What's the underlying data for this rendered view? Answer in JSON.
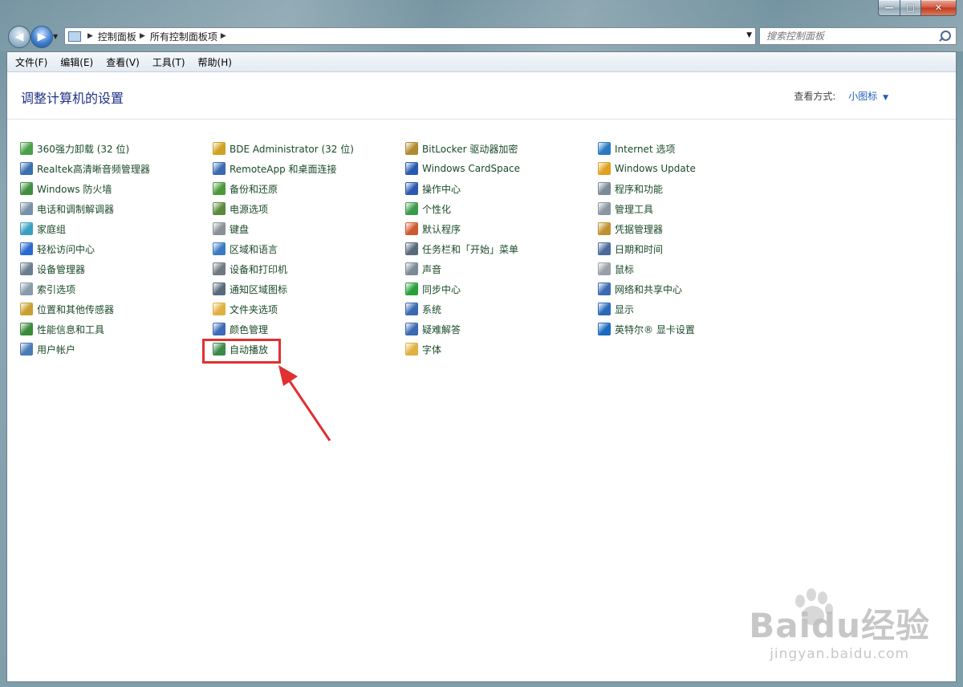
{
  "window": {
    "caption_buttons": {
      "minimize": "—",
      "maximize": "□",
      "close": "✕"
    }
  },
  "nav": {
    "back_icon": "back-arrow-icon",
    "forward_icon": "forward-arrow-icon",
    "address_crumbs": [
      "控制面板",
      "所有控制面板项"
    ],
    "search_placeholder": "搜索控制面板"
  },
  "menubar": {
    "items": [
      "文件(F)",
      "编辑(E)",
      "查看(V)",
      "工具(T)",
      "帮助(H)"
    ]
  },
  "header": {
    "title": "调整计算机的设置",
    "view_by_label": "查看方式:",
    "view_by_value": "小图标"
  },
  "columns": [
    {
      "items": [
        {
          "label": "360强力卸载 (32 位)",
          "icon": "uninstall-icon",
          "color": "#4aa04a"
        },
        {
          "label": "Realtek高清晰音频管理器",
          "icon": "audio-manager-icon",
          "color": "#3a6fb0"
        },
        {
          "label": "Windows 防火墙",
          "icon": "firewall-icon",
          "color": "#3f8f3f"
        },
        {
          "label": "电话和调制解调器",
          "icon": "phone-modem-icon",
          "color": "#7890a8"
        },
        {
          "label": "家庭组",
          "icon": "homegroup-icon",
          "color": "#3aa0c0"
        },
        {
          "label": "轻松访问中心",
          "icon": "ease-access-icon",
          "color": "#2a6ad0"
        },
        {
          "label": "设备管理器",
          "icon": "device-manager-icon",
          "color": "#6a7e90"
        },
        {
          "label": "索引选项",
          "icon": "indexing-icon",
          "color": "#8a9aaa"
        },
        {
          "label": "位置和其他传感器",
          "icon": "sensor-icon",
          "color": "#c8a030"
        },
        {
          "label": "性能信息和工具",
          "icon": "performance-icon",
          "color": "#3a8a3a"
        },
        {
          "label": "用户帐户",
          "icon": "user-accounts-icon",
          "color": "#4a7ab8"
        }
      ]
    },
    {
      "items": [
        {
          "label": "BDE Administrator (32 位)",
          "icon": "bde-icon",
          "color": "#d0a020"
        },
        {
          "label": "RemoteApp 和桌面连接",
          "icon": "remoteapp-icon",
          "color": "#3a6ab0"
        },
        {
          "label": "备份和还原",
          "icon": "backup-icon",
          "color": "#4a9a3a"
        },
        {
          "label": "电源选项",
          "icon": "power-icon",
          "color": "#5a8a3a"
        },
        {
          "label": "键盘",
          "icon": "keyboard-icon",
          "color": "#8a9096"
        },
        {
          "label": "区域和语言",
          "icon": "region-icon",
          "color": "#3a7ac0"
        },
        {
          "label": "设备和打印机",
          "icon": "printer-icon",
          "color": "#707880"
        },
        {
          "label": "通知区域图标",
          "icon": "notification-icon",
          "color": "#5a6a7a"
        },
        {
          "label": "文件夹选项",
          "icon": "folder-options-icon",
          "color": "#e0b040"
        },
        {
          "label": "颜色管理",
          "icon": "color-management-icon",
          "color": "#3a6ab8"
        },
        {
          "label": "自动播放",
          "icon": "autoplay-icon",
          "color": "#3a8a4a"
        }
      ]
    },
    {
      "items": [
        {
          "label": "BitLocker 驱动器加密",
          "icon": "bitlocker-icon",
          "color": "#b08a30"
        },
        {
          "label": "Windows CardSpace",
          "icon": "cardspace-icon",
          "color": "#2a5ab0"
        },
        {
          "label": "操作中心",
          "icon": "action-center-flag-icon",
          "color": "#2a5ab0"
        },
        {
          "label": "个性化",
          "icon": "personalize-icon",
          "color": "#3a9a4a"
        },
        {
          "label": "默认程序",
          "icon": "default-programs-icon",
          "color": "#d05a30"
        },
        {
          "label": "任务栏和「开始」菜单",
          "icon": "taskbar-icon",
          "color": "#5a6a7a"
        },
        {
          "label": "声音",
          "icon": "speaker-icon",
          "color": "#7a8a96"
        },
        {
          "label": "同步中心",
          "icon": "sync-icon",
          "color": "#2aa03a"
        },
        {
          "label": "系统",
          "icon": "system-icon",
          "color": "#3a6ab0"
        },
        {
          "label": "疑难解答",
          "icon": "troubleshoot-icon",
          "color": "#3a6ab0"
        },
        {
          "label": "字体",
          "icon": "fonts-icon",
          "color": "#e0b040"
        }
      ]
    },
    {
      "items": [
        {
          "label": "Internet 选项",
          "icon": "internet-options-icon",
          "color": "#2a7ac0"
        },
        {
          "label": "Windows Update",
          "icon": "windows-update-icon",
          "color": "#e0a020"
        },
        {
          "label": "程序和功能",
          "icon": "programs-features-icon",
          "color": "#7a8a96"
        },
        {
          "label": "管理工具",
          "icon": "admin-tools-icon",
          "color": "#8a96a0"
        },
        {
          "label": "凭据管理器",
          "icon": "credential-icon",
          "color": "#c09030"
        },
        {
          "label": "日期和时间",
          "icon": "clock-icon",
          "color": "#4a6a9a"
        },
        {
          "label": "鼠标",
          "icon": "mouse-icon",
          "color": "#9aa0a6"
        },
        {
          "label": "网络和共享中心",
          "icon": "network-icon",
          "color": "#3a6ab0"
        },
        {
          "label": "显示",
          "icon": "display-icon",
          "color": "#2a6ab8"
        },
        {
          "label": "英特尔® 显卡设置",
          "icon": "intel-graphics-icon",
          "color": "#1a6ac0"
        }
      ]
    }
  ],
  "annotation": {
    "highlight_color": "#e03030"
  },
  "watermark": {
    "logo": "Baidu经验",
    "url": "jingyan.baidu.com"
  }
}
